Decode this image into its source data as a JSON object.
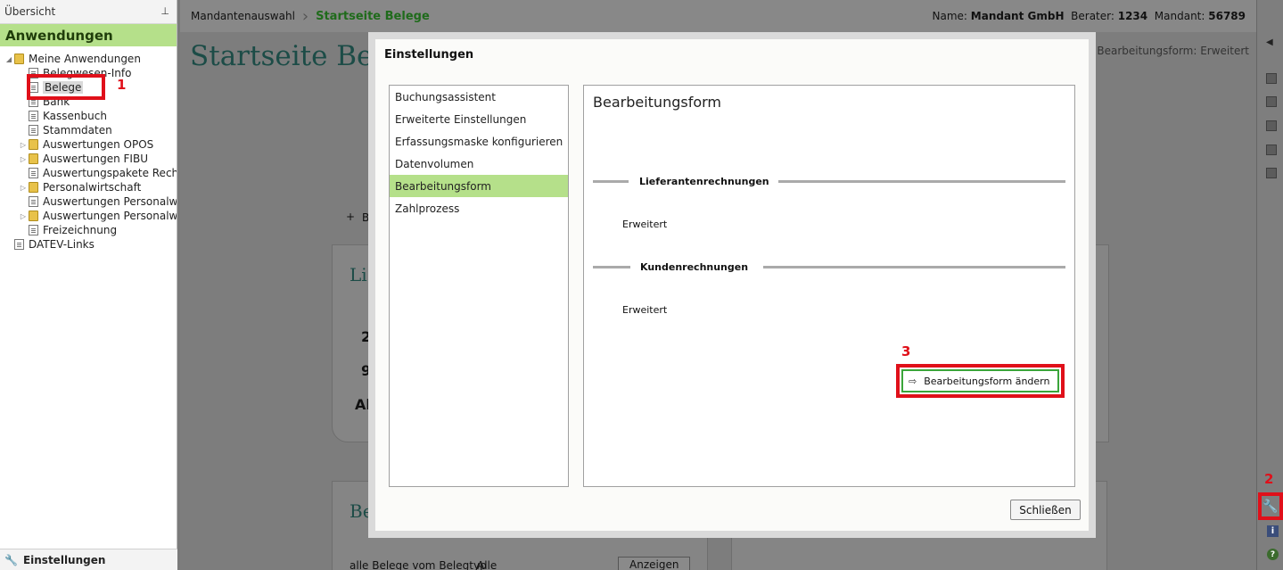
{
  "left_panel": {
    "header": "Übersicht",
    "pin_icon": "pin-icon",
    "section_title": "Anwendungen",
    "tree": [
      {
        "label": "Meine Anwendungen",
        "level": 0,
        "type": "folder",
        "expanded": true
      },
      {
        "label": "Belegwesen-Info",
        "level": 1,
        "type": "doc"
      },
      {
        "label": "Belege",
        "level": 1,
        "type": "doc",
        "selected": true
      },
      {
        "label": "Bank",
        "level": 1,
        "type": "doc"
      },
      {
        "label": "Kassenbuch",
        "level": 1,
        "type": "doc"
      },
      {
        "label": "Stammdaten",
        "level": 1,
        "type": "doc"
      },
      {
        "label": "Auswertungen OPOS",
        "level": 1,
        "type": "folder"
      },
      {
        "label": "Auswertungen FIBU",
        "level": 1,
        "type": "folder"
      },
      {
        "label": "Auswertungspakete Rechnu",
        "level": 1,
        "type": "doc"
      },
      {
        "label": "Personalwirtschaft",
        "level": 1,
        "type": "folder"
      },
      {
        "label": "Auswertungen Personalwirt",
        "level": 1,
        "type": "doc"
      },
      {
        "label": "Auswertungen Personalwirt",
        "level": 1,
        "type": "folder"
      },
      {
        "label": "Freizeichnung",
        "level": 1,
        "type": "doc"
      },
      {
        "label": "DATEV-Links",
        "level": 0,
        "type": "doc"
      }
    ],
    "footer": "Einstellungen"
  },
  "annotations": {
    "step1": "1",
    "step2": "2",
    "step3": "3"
  },
  "topbar": {
    "crumb1": "Mandantenauswahl",
    "crumb2": "Startseite Belege",
    "name_label": "Name:",
    "name_value": "Mandant GmbH",
    "berater_label": "Berater:",
    "berater_value": "1234",
    "mandant_label": "Mandant:",
    "mandant_value": "56789"
  },
  "main": {
    "title": "Startseite Bele",
    "subtitle": "gen Bearbeitungsform: Erweitert",
    "bg_snippets": [
      "B",
      "Li",
      "2",
      "9",
      "Al",
      "Be",
      "alle Belege vom Belegtyp",
      "Alle",
      "Anzeigen"
    ]
  },
  "modal": {
    "title": "Einstellungen",
    "nav": [
      {
        "label": "Buchungsassistent"
      },
      {
        "label": "Erweiterte Einstellungen"
      },
      {
        "label": "Erfassungsmaske konfigurieren"
      },
      {
        "label": "Datenvolumen"
      },
      {
        "label": "Bearbeitungsform",
        "active": true
      },
      {
        "label": "Zahlprozess"
      }
    ],
    "content_title": "Bearbeitungsform",
    "section1_label": "Lieferantenrechnungen",
    "section1_value": "Erweitert",
    "section2_label": "Kundenrechnungen",
    "section2_value": "Erweitert",
    "change_button": "Bearbeitungsform ändern",
    "close_button": "Schließen"
  },
  "colors": {
    "accent_green": "#b5e08a",
    "annotation_red": "#e0101a",
    "title_teal": "#1c4c47"
  }
}
